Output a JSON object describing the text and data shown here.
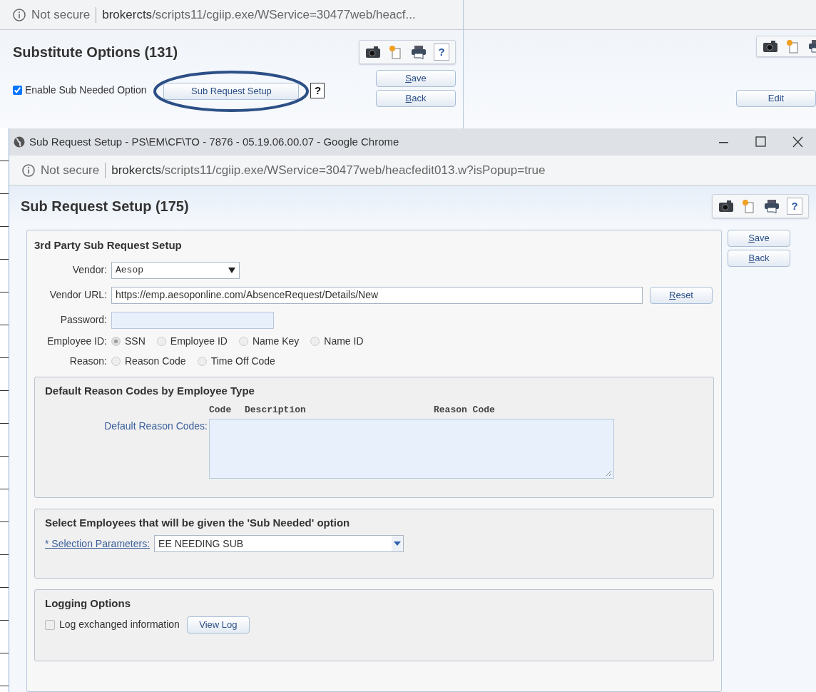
{
  "back_window": {
    "address_bar": {
      "security": "Not secure",
      "host": "brokercts",
      "path": "/scripts11/cgiip.exe/WService=30477web/heacf..."
    },
    "title": "Substitute Options (131)",
    "toolbar_help": "?",
    "enable_sub_needed": {
      "label": "Enable Sub Needed Option",
      "checked": true
    },
    "setup_button": "Sub Request Setup",
    "help_box": "?",
    "buttons": [
      "Save",
      "Back"
    ],
    "edit_button": "Edit"
  },
  "popup": {
    "window_title": "Sub Request Setup - PS\\EM\\CF\\TO - 7876 - 05.19.06.00.07 - Google Chrome",
    "address_bar": {
      "security": "Not secure",
      "host": "brokercts",
      "path": "/scripts11/cgiip.exe/WService=30477web/heacfedit013.w?isPopup=true"
    },
    "title": "Sub Request Setup (175)",
    "toolbar_help": "?",
    "third_party": {
      "heading": "3rd Party Sub Request Setup",
      "vendor": {
        "label": "Vendor:",
        "value": "Aesop"
      },
      "vendor_url": {
        "label": "Vendor URL:",
        "value": "https://emp.aesoponline.com/AbsenceRequest/Details/New"
      },
      "reset_button": "Reset",
      "password": {
        "label": "Password:"
      },
      "employee_id": {
        "label": "Employee ID:",
        "options": [
          {
            "label": "SSN",
            "selected": true
          },
          {
            "label": "Employee ID",
            "selected": false
          },
          {
            "label": "Name Key",
            "selected": false
          },
          {
            "label": "Name ID",
            "selected": false
          }
        ]
      },
      "reason": {
        "label": "Reason:",
        "options": [
          {
            "label": "Reason Code",
            "selected": false
          },
          {
            "label": "Time Off Code",
            "selected": false
          }
        ]
      }
    },
    "default_reason_codes": {
      "heading": "Default Reason Codes by Employee Type",
      "columns": [
        "Code",
        "Description",
        "Reason Code"
      ],
      "label": "Default Reason Codes:"
    },
    "select_employees": {
      "heading": "Select Employees that will be given the 'Sub Needed' option",
      "label": "* Selection Parameters:",
      "value": "EE NEEDING SUB"
    },
    "logging": {
      "heading": "Logging Options",
      "log_exchanged": {
        "label": "Log exchanged information",
        "checked": false
      },
      "view_log_button": "View Log"
    },
    "buttons": [
      "Save",
      "Back"
    ]
  }
}
